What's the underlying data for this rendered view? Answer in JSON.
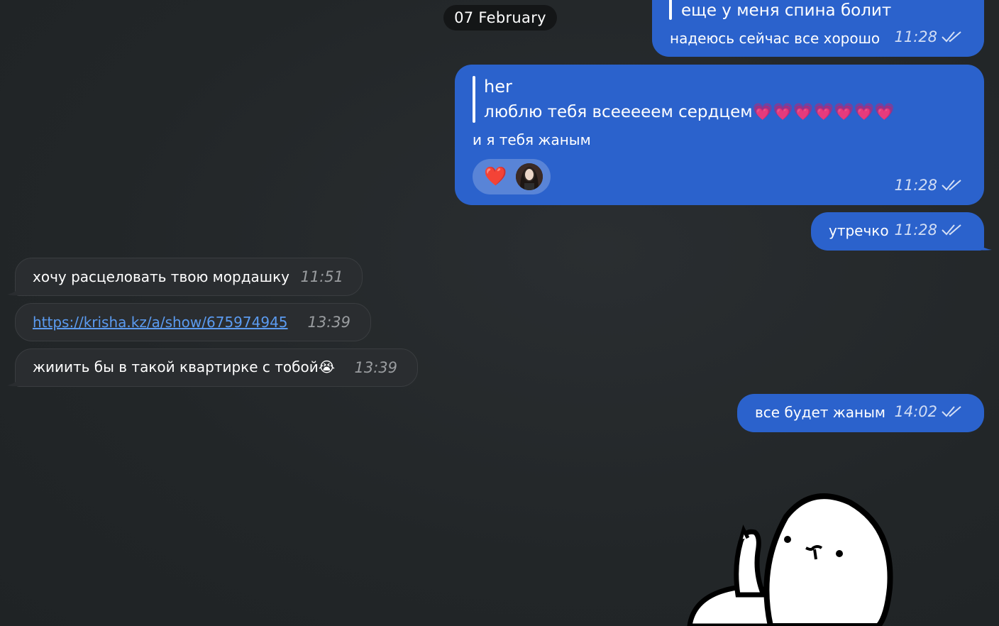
{
  "date_separator": "07 February",
  "messages": [
    {
      "direction": "out",
      "quote": "еще у меня спина болит",
      "text": "надеюсь сейчас все хорошо",
      "time": "11:28"
    },
    {
      "direction": "out",
      "reply_author": "her",
      "reply_text": "люблю тебя всееееем сердцем💗💗💗💗💗💗💗",
      "text": "и я тебя жаным",
      "reaction": "❤️",
      "time": "11:28"
    },
    {
      "direction": "out",
      "text": "утречко",
      "time": "11:28"
    },
    {
      "direction": "in",
      "text": "хочу расцеловать твою мордашку",
      "time": "11:51"
    },
    {
      "direction": "in",
      "text": "https://krisha.kz/a/show/675974945",
      "time": "13:39",
      "is_link": true
    },
    {
      "direction": "in",
      "text": "жииить бы в такой квартирке с тобой😭",
      "time": "13:39"
    },
    {
      "direction": "out",
      "text": "все будет жаным",
      "time": "14:02"
    }
  ],
  "colors": {
    "outgoing": "#2b62cc",
    "incoming": "#2a2d30",
    "background": "#222628"
  }
}
